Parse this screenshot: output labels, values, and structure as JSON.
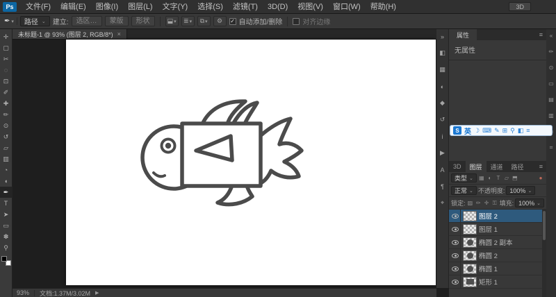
{
  "icons": {
    "dropdown": "⌄",
    "dropdown_small": "▾",
    "menu": "≡",
    "close": "×",
    "check": "✓",
    "arrow_right": "▶"
  },
  "menubar": {
    "logo": "Ps",
    "items": [
      "文件(F)",
      "编辑(E)",
      "图像(I)",
      "图层(L)",
      "文字(Y)",
      "选择(S)",
      "滤镜(T)",
      "3D(D)",
      "视图(V)",
      "窗口(W)",
      "帮助(H)"
    ],
    "workspace": "3D"
  },
  "optionsbar": {
    "tool_glyph": "✒",
    "mode_value": "路径",
    "make_label": "建立:",
    "selection_button": "选区…",
    "mask_button": "蒙版",
    "shape_button": "形状",
    "op_icons": [
      {
        "name": "path-operations-icon",
        "glyph": "⬓"
      },
      {
        "name": "path-alignment-icon",
        "glyph": "≣"
      },
      {
        "name": "path-arrange-icon",
        "glyph": "⧉"
      }
    ],
    "gear_glyph": "⚙",
    "auto_add_label": "自动添加/删除",
    "align_edges_label": "对齐边缘"
  },
  "toolbar": {
    "tools": [
      {
        "name": "move-tool",
        "glyph": "✛"
      },
      {
        "name": "marquee-tool",
        "glyph": "▢"
      },
      {
        "name": "lasso-tool",
        "glyph": "✂"
      },
      {
        "name": "quick-selection-tool",
        "glyph": "◌"
      },
      {
        "name": "crop-tool",
        "glyph": "⊡"
      },
      {
        "name": "eyedropper-tool",
        "glyph": "✐"
      },
      {
        "name": "healing-brush-tool",
        "glyph": "✚"
      },
      {
        "name": "brush-tool",
        "glyph": "✏"
      },
      {
        "name": "clone-stamp-tool",
        "glyph": "⊙"
      },
      {
        "name": "history-brush-tool",
        "glyph": "↺"
      },
      {
        "name": "eraser-tool",
        "glyph": "▱"
      },
      {
        "name": "gradient-tool",
        "glyph": "▥"
      },
      {
        "name": "blur-tool",
        "glyph": "◔"
      },
      {
        "name": "dodge-tool",
        "glyph": "◖"
      },
      {
        "name": "pen-tool",
        "glyph": "✒"
      },
      {
        "name": "type-tool",
        "glyph": "T"
      },
      {
        "name": "path-selection-tool",
        "glyph": "➤"
      },
      {
        "name": "shape-tool",
        "glyph": "▭"
      },
      {
        "name": "hand-tool",
        "glyph": "✽"
      },
      {
        "name": "zoom-tool",
        "glyph": "⚲"
      }
    ]
  },
  "document": {
    "tab_title": "未标题-1 @ 93% (图层 2, RGB/8*)"
  },
  "statusbar": {
    "zoom": "93%",
    "doc_info": "文档:1.37M/3.02M"
  },
  "dock_strip": {
    "icons": [
      {
        "name": "collapse-panels-icon",
        "glyph": "»"
      },
      {
        "name": "color-panel-icon",
        "glyph": "◧"
      },
      {
        "name": "swatches-panel-icon",
        "glyph": "▦"
      },
      {
        "name": "adjustments-panel-icon",
        "glyph": "◐"
      },
      {
        "name": "styles-panel-icon",
        "glyph": "◆"
      },
      {
        "name": "history-panel-icon",
        "glyph": "↺"
      },
      {
        "name": "info-panel-icon",
        "glyph": "i"
      },
      {
        "name": "actions-panel-icon",
        "glyph": "▶"
      },
      {
        "name": "character-panel-icon",
        "glyph": "A"
      },
      {
        "name": "paragraph-panel-icon",
        "glyph": "¶"
      },
      {
        "name": "navigator-panel-icon",
        "glyph": "⌖"
      }
    ]
  },
  "edge_strip": {
    "icons": [
      {
        "name": "expand-dock-icon",
        "glyph": "«"
      },
      {
        "name": "brush-presets-panel-icon",
        "glyph": "✏"
      },
      {
        "name": "clone-source-panel-icon",
        "glyph": "⊙"
      },
      {
        "name": "timeline-panel-icon",
        "glyph": "▭"
      },
      {
        "name": "notes-panel-icon",
        "glyph": "▤"
      },
      {
        "name": "histogram-panel-icon",
        "glyph": "▥"
      },
      {
        "name": "layer-comps-panel-icon",
        "glyph": "⧉"
      },
      {
        "name": "measurement-panel-icon",
        "glyph": "⌗"
      }
    ]
  },
  "properties_panel": {
    "tab": "属性",
    "empty_text": "无属性"
  },
  "ime_bar": {
    "logo_glyph": "S",
    "mode": "英",
    "icons": [
      {
        "name": "ime-moon-icon",
        "glyph": "☽"
      },
      {
        "name": "ime-keyboard-icon",
        "glyph": "⌨"
      },
      {
        "name": "ime-handwriting-icon",
        "glyph": "✎"
      },
      {
        "name": "ime-clipboard-icon",
        "glyph": "⊞"
      },
      {
        "name": "ime-search-icon",
        "glyph": "⚲"
      },
      {
        "name": "ime-skin-icon",
        "glyph": "◧"
      },
      {
        "name": "ime-menu-icon",
        "glyph": "≡"
      }
    ]
  },
  "layers_panel": {
    "tabs": [
      "3D",
      "图层",
      "通道",
      "路径"
    ],
    "filter_label": "类型",
    "filter_icons": [
      {
        "name": "filter-pixel-layers-icon",
        "glyph": "▦"
      },
      {
        "name": "filter-adjustment-layers-icon",
        "glyph": "◐"
      },
      {
        "name": "filter-type-layers-icon",
        "glyph": "T"
      },
      {
        "name": "filter-shape-layers-icon",
        "glyph": "▱"
      },
      {
        "name": "filter-smart-objects-icon",
        "glyph": "⬒"
      }
    ],
    "filter_toggle_glyph": "●",
    "blend_mode": "正常",
    "opacity_label": "不透明度:",
    "opacity_value": "100%",
    "lock_label": "锁定:",
    "lock_icons": [
      {
        "name": "lock-transparency-icon",
        "glyph": "▨"
      },
      {
        "name": "lock-pixels-icon",
        "glyph": "✏"
      },
      {
        "name": "lock-position-icon",
        "glyph": "✛"
      },
      {
        "name": "lock-all-icon",
        "glyph": "⚿"
      }
    ],
    "fill_label": "填充:",
    "fill_value": "100%",
    "layers": [
      {
        "name": "图层 2"
      },
      {
        "name": "图层 1"
      },
      {
        "name": "椭圆 2 副本"
      },
      {
        "name": "椭圆 2"
      },
      {
        "name": "椭圆 1"
      },
      {
        "name": "矩形 1"
      }
    ]
  }
}
